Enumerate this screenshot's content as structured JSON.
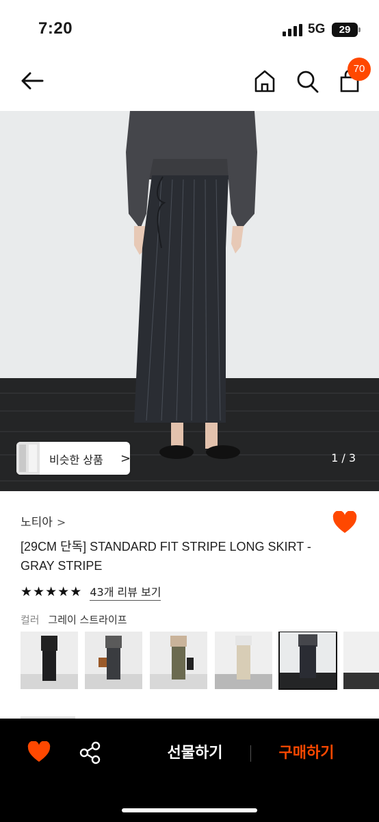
{
  "status_bar": {
    "time": "7:20",
    "network": "5G",
    "battery": "29"
  },
  "nav": {
    "back_icon": "arrow-left-icon",
    "home_icon": "home-icon",
    "search_icon": "search-icon",
    "bag_icon": "shopping-bag-icon",
    "cart_count": "70"
  },
  "gallery": {
    "similar_label": "비슷한 상품",
    "similar_chevron": ">",
    "counter": "1 / 3"
  },
  "product": {
    "brand": "노티아",
    "brand_chevron": ">",
    "title": "[29CM 단독] STANDARD FIT STRIPE LONG SKIRT - GRAY STRIPE",
    "stars": [
      "★",
      "★",
      "★",
      "★",
      "★"
    ],
    "review_link": "43개 리뷰 보기",
    "color_label": "컬러",
    "color_value": "그레이 스트라이프",
    "swatch_colors": [
      "#1e1e20",
      "#3a3c40",
      "#6b6a50",
      "#d8cdb6",
      "#2a2c33",
      "#333"
    ],
    "selected_swatch": 4
  },
  "bottom_bar": {
    "gift_label": "선물하기",
    "buy_label": "구매하기"
  },
  "colors": {
    "accent": "#ff4800",
    "heart": "#ff4800"
  }
}
